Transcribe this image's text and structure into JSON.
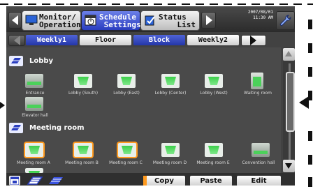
{
  "header": {
    "modes": [
      {
        "label": "Monitor/\nOperation",
        "icon": "monitor-icon",
        "active": false
      },
      {
        "label": "Schedule\n Settings",
        "icon": "schedule-icon",
        "active": true
      },
      {
        "label": "Status\n    List",
        "icon": "status-list-icon",
        "active": false
      }
    ],
    "date": "2007/08/01",
    "time": "11:30 AM",
    "settings_icon": "wrench-icon"
  },
  "tabs": [
    {
      "label": "Weekly1",
      "style": "blue"
    },
    {
      "label": "Floor",
      "style": "white"
    },
    {
      "label": "Block",
      "style": "blue"
    },
    {
      "label": "Weekly2",
      "style": "white"
    }
  ],
  "groups": [
    {
      "title": "Lobby",
      "units": [
        {
          "label": "Entrance",
          "type": "wall",
          "selected": false
        },
        {
          "label": "Lobby (South)",
          "type": "cassette",
          "selected": false
        },
        {
          "label": "Lobby (East)",
          "type": "cassette",
          "selected": false
        },
        {
          "label": "Lobby (Center)",
          "type": "cassette",
          "selected": false
        },
        {
          "label": "Lobby (West)",
          "type": "cassette",
          "selected": false
        },
        {
          "label": "Waiting room",
          "type": "floor",
          "selected": false
        },
        {
          "label": "Elevator hall",
          "type": "wall",
          "selected": false
        }
      ]
    },
    {
      "title": "Meeting room",
      "units": [
        {
          "label": "Meeting room A",
          "type": "cassette",
          "selected": true
        },
        {
          "label": "Meeting room B",
          "type": "cassette",
          "selected": true
        },
        {
          "label": "Meeting room C",
          "type": "cassette",
          "selected": true
        },
        {
          "label": "Meeting room D",
          "type": "cassette",
          "selected": false
        },
        {
          "label": "Meeting room E",
          "type": "cassette",
          "selected": false
        },
        {
          "label": "Convention hall",
          "type": "wall",
          "selected": false
        }
      ]
    }
  ],
  "actions": {
    "copy": "Copy",
    "paste": "Paste",
    "edit": "Edit"
  },
  "colors": {
    "accent_blue": "#2a3ec0",
    "selected_outline": "#ff9a1f",
    "unit_green": "#4bd15a",
    "background": "#424242"
  }
}
